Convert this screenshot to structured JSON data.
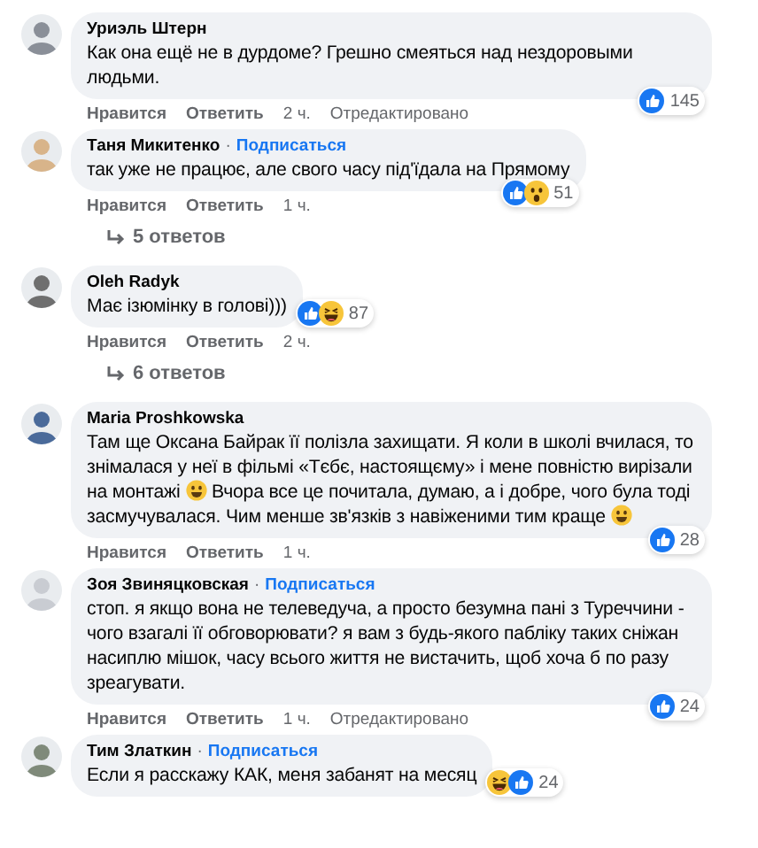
{
  "comments": [
    {
      "author": "Уриэль Штерн",
      "body": [
        {
          "kind": "text",
          "text": "Как она ещё не в дурдоме? Грешно смеяться над нездоровыми людьми."
        }
      ],
      "reactions": [
        {
          "kind": "like"
        }
      ],
      "reaction_count": "145",
      "actions": [
        "Нравится",
        "Ответить"
      ],
      "time": "2 ч.",
      "edited": "Отредактировано"
    },
    {
      "author": "Таня Микитенко",
      "separator": "·",
      "follow": "Подписаться",
      "body": [
        {
          "kind": "text",
          "text": "так уже не працює, але свого часу під'їдала на Прямому"
        }
      ],
      "reactions": [
        {
          "kind": "like"
        },
        {
          "kind": "wow"
        }
      ],
      "reaction_count": "51",
      "actions": [
        "Нравится",
        "Ответить"
      ],
      "time": "1 ч.",
      "replies": "5 ответов"
    },
    {
      "author": "Oleh Radyk",
      "body": [
        {
          "kind": "text",
          "text": "Має ізюмінку в голові)))"
        }
      ],
      "reactions": [
        {
          "kind": "like"
        },
        {
          "kind": "haha"
        }
      ],
      "reaction_count": "87",
      "actions": [
        "Нравится",
        "Ответить"
      ],
      "time": "2 ч.",
      "replies": "6 ответов"
    },
    {
      "author": "Maria Proshkowska",
      "body": [
        {
          "kind": "text",
          "text": "Там ще Оксана Байрак її полізла захищати. Я коли в школі вчилася, то знімалася у неї в фільмі «Тєбє, настоящєму» і мене повністю вирізали на монтажі "
        },
        {
          "kind": "emoji"
        },
        {
          "kind": "text",
          "text": " Вчора все це почитала, думаю, а і добре, чого була тоді засмучувалася. Чим менше зв'язків з навіженими тим краще "
        },
        {
          "kind": "emoji"
        }
      ],
      "reactions": [
        {
          "kind": "like"
        }
      ],
      "reaction_count": "28",
      "actions": [
        "Нравится",
        "Ответить"
      ],
      "time": "1 ч."
    },
    {
      "author": "Зоя Звиняцковская",
      "separator": "·",
      "follow": "Подписаться",
      "body": [
        {
          "kind": "text",
          "text": "стоп. я якщо вона не телеведуча, а просто безумна пані з Туреччини - чого взагалі її обговорювати? я вам з будь-якого пабліку таких сніжан насиплю мішок, часу всього життя не вистачить, щоб хоча б по разу зреагувати."
        }
      ],
      "reactions": [
        {
          "kind": "like"
        }
      ],
      "reaction_count": "24",
      "actions": [
        "Нравится",
        "Ответить"
      ],
      "time": "1 ч.",
      "edited": "Отредактировано"
    },
    {
      "author": "Тим Златкин",
      "separator": "·",
      "follow": "Подписаться",
      "body": [
        {
          "kind": "text",
          "text": "Если я расскажу КАК, меня забанят на месяц"
        }
      ],
      "reactions": [
        {
          "kind": "haha"
        },
        {
          "kind": "like"
        }
      ],
      "reaction_count": "24"
    }
  ]
}
